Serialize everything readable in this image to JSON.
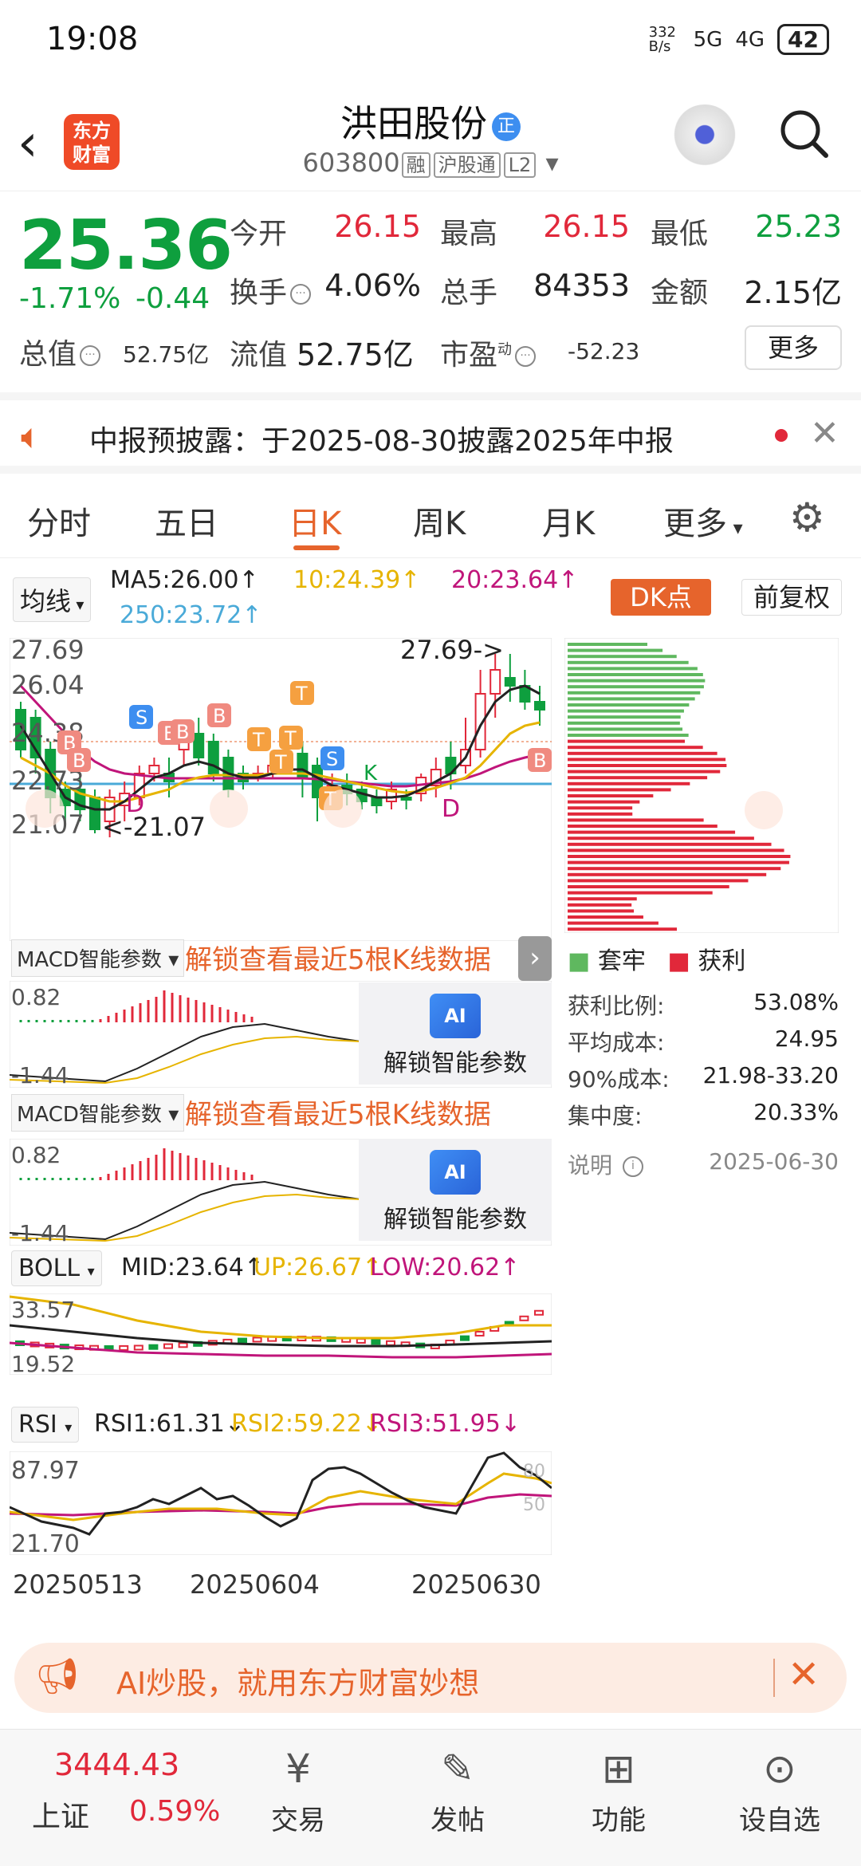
{
  "status_bar": {
    "time": "19:08",
    "net_speed": "332 B/s",
    "signal1": "5G",
    "signal2": "4G",
    "battery": "42"
  },
  "header": {
    "logo_text": "东方财富",
    "title": "洪田股份",
    "title_badge": "正",
    "code": "603800",
    "tags": [
      "融",
      "沪股通",
      "L2"
    ]
  },
  "quote": {
    "price": "25.36",
    "change_pct": "-1.71%",
    "change": "-0.44",
    "market_value_label": "总值",
    "market_value": "52.75亿",
    "items": [
      {
        "label": "今开",
        "value": "26.15",
        "color": "red"
      },
      {
        "label": "最高",
        "value": "26.15",
        "color": "red"
      },
      {
        "label": "最低",
        "value": "25.23",
        "color": "green"
      },
      {
        "label": "换手",
        "value": "4.06%",
        "color": "blk"
      },
      {
        "label": "总手",
        "value": "84353",
        "color": "blk"
      },
      {
        "label": "金额",
        "value": "2.15亿",
        "color": "blk"
      },
      {
        "label": "流值",
        "value": "52.75亿",
        "color": "blk"
      },
      {
        "label": "市盈",
        "value": "-52.23",
        "color": "blk"
      }
    ],
    "pe_sup": "动",
    "more_label": "更多"
  },
  "notice": {
    "text": "中报预披露：于2025-08-30披露2025年中报"
  },
  "tabs": [
    "分时",
    "五日",
    "日K",
    "周K",
    "月K",
    "更多"
  ],
  "active_tab": "日K",
  "ma_bar": {
    "selector": "均线",
    "ma5": "MA5:26.00↑",
    "ma10": "10:24.39↑",
    "ma20": "20:23.64↑",
    "ma250": "250:23.72↑",
    "dk_label": "DK点",
    "fq_label": "前复权"
  },
  "kline": {
    "y_labels": [
      "27.69",
      "26.04",
      "24.38",
      "22.73",
      "21.07"
    ],
    "high_mark": "27.69->",
    "low_mark": "<-21.07"
  },
  "macd1": {
    "selector": "MACD智能参数",
    "tip": "解锁查看最近5根K线数据",
    "y_top": "0.82",
    "y_bot": "-1.44",
    "unlock": "解锁智能参数"
  },
  "macd2": {
    "selector": "MACD智能参数",
    "tip": "解锁查看最近5根K线数据",
    "y_top": "0.82",
    "y_bot": "-1.44",
    "unlock": "解锁智能参数"
  },
  "boll": {
    "selector": "BOLL",
    "mid": "MID:23.64↑",
    "up": "UP:26.67↑",
    "low": "LOW:20.62↑",
    "y_top": "33.57",
    "y_bot": "19.52"
  },
  "rsi": {
    "selector": "RSI",
    "rsi1": "RSI1:61.31↓",
    "rsi2": "RSI2:59.22↓",
    "rsi3": "RSI3:51.95↓",
    "y_top": "87.97",
    "y_bot": "21.70",
    "lv80": "80",
    "lv50": "50"
  },
  "x_dates": [
    "20250513",
    "20250604",
    "20250630"
  ],
  "chips": {
    "legend_trap": "套牢",
    "legend_profit": "获利",
    "rows": [
      {
        "label": "获利比例:",
        "value": "53.08%"
      },
      {
        "label": "平均成本:",
        "value": "24.95"
      },
      {
        "label": "90%成本:",
        "value": "21.98-33.20"
      },
      {
        "label": "集中度:",
        "value": "20.33%"
      }
    ],
    "note_label": "说明",
    "date": "2025-06-30"
  },
  "ad": {
    "text": "AI炒股，就用东方财富妙想"
  },
  "bottom": {
    "index_value": "3444.43",
    "index_name": "上证",
    "index_change": "0.59%",
    "nav": [
      {
        "label": "交易",
        "icon": "yen-icon"
      },
      {
        "label": "发帖",
        "icon": "edit-icon"
      },
      {
        "label": "功能",
        "icon": "grid-icon"
      },
      {
        "label": "设自选",
        "icon": "more-icon"
      }
    ]
  },
  "colors": {
    "accent": "#e6642c",
    "up": "#e1283a",
    "down": "#0e9f3e"
  }
}
